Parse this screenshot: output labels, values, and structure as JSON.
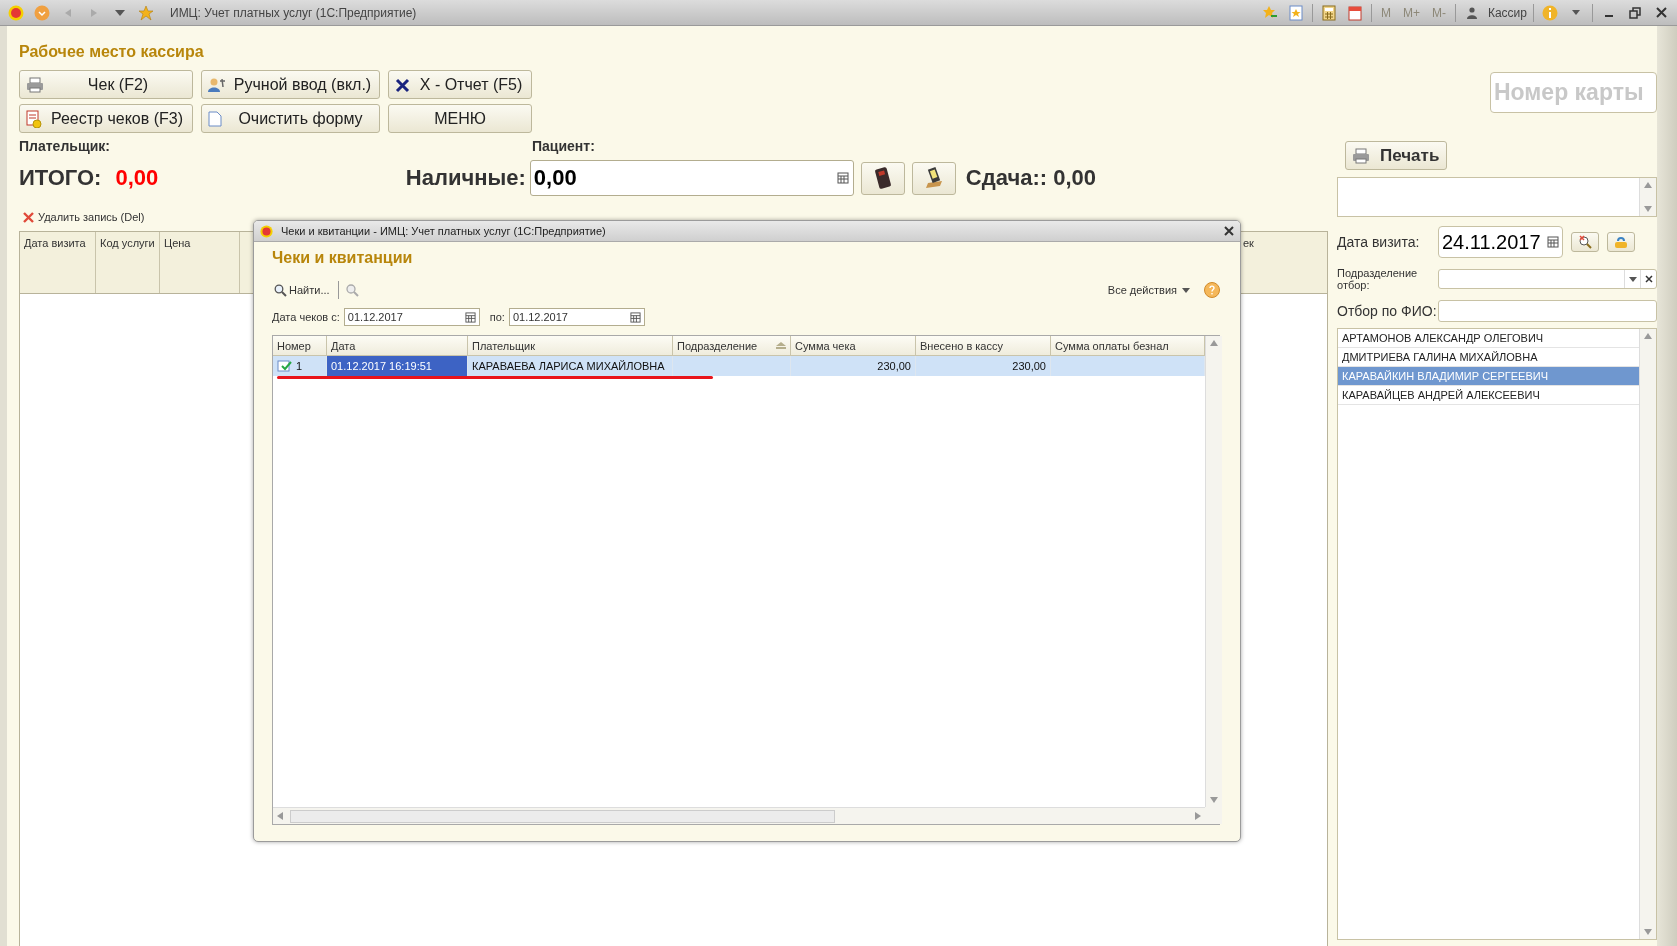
{
  "app_bar": {
    "title": "ИМЦ: Учет платных услуг  (1С:Предприятие)",
    "memory_buttons": [
      {
        "label": "M",
        "disabled": true
      },
      {
        "label": "M+",
        "disabled": true
      },
      {
        "label": "M-",
        "disabled": true
      }
    ],
    "user": "Кассир"
  },
  "form": {
    "title": "Рабочее место кассира",
    "buttons": [
      {
        "label": "Чек (F2)",
        "kind": "printer"
      },
      {
        "label": "Ручной ввод (вкл.)",
        "kind": "manual"
      },
      {
        "label": "X - Отчет (F5)",
        "kind": "report"
      },
      {
        "label": "Реестр чеков (F3)",
        "kind": "registry"
      },
      {
        "label": "Очистить форму",
        "kind": "clear"
      },
      {
        "label": "МЕНЮ",
        "kind": "plain"
      }
    ],
    "payer_label": "Плательщик:",
    "patient_label": "Пациент:",
    "total_label": "ИТОГО:",
    "total_value": "0,00",
    "cash_label": "Наличные:",
    "cash_value": "0,00",
    "change_label": "Сдача::",
    "change_value": "0,00",
    "delete_action": "Удалить запись (Del)",
    "table_columns": [
      "Дата визита",
      "Код услуги",
      "Цена",
      "ек"
    ]
  },
  "side": {
    "card_placeholder": "Номер карты",
    "print_button": "Печать",
    "visit_date_label": "Дата визита:",
    "visit_date": "24.11.2017",
    "department_label": "Подразделение отбор:",
    "name_filter_label": "Отбор по ФИО:",
    "patients": [
      {
        "name": "АРТАМОНОВ АЛЕКСАНДР ОЛЕГОВИЧ",
        "selected": false
      },
      {
        "name": "ДМИТРИЕВА ГАЛИНА МИХАЙЛОВНА",
        "selected": false
      },
      {
        "name": "КАРАВАЙКИН ВЛАДИМИР СЕРГЕЕВИЧ",
        "selected": true
      },
      {
        "name": "КАРАВАЙЦЕВ АНДРЕЙ АЛЕКСЕЕВИЧ",
        "selected": false
      }
    ]
  },
  "dialog": {
    "window_title": "Чеки и квитанции - ИМЦ: Учет платных услуг  (1С:Предприятие)",
    "title": "Чеки и квитанции",
    "find_button": "Найти...",
    "all_actions": "Все действия",
    "date_from_label": "Дата чеков с:",
    "date_from": "01.12.2017",
    "date_to_label": "по:",
    "date_to": "01.12.2017",
    "columns": [
      {
        "label": "Номер",
        "sorted": false
      },
      {
        "label": "Дата",
        "sorted": false
      },
      {
        "label": "Плательщик",
        "sorted": false
      },
      {
        "label": "Подразделение",
        "sorted": true
      },
      {
        "label": "Сумма чека",
        "sorted": false
      },
      {
        "label": "Внесено в кассу",
        "sorted": false
      },
      {
        "label": "Сумма оплаты безнал",
        "sorted": false
      }
    ],
    "rows": [
      {
        "selected": true,
        "underlined": true,
        "posted": true,
        "cells": [
          {
            "text": "1",
            "active": false
          },
          {
            "text": "01.12.2017 16:19:51",
            "active": true
          },
          {
            "text": "КАРАВАЕВА ЛАРИСА МИХАЙЛОВНА",
            "active": false
          },
          {
            "active": false
          },
          {
            "text": "230,00",
            "active": false
          },
          {
            "text": "230,00",
            "active": false
          },
          {
            "active": false
          }
        ]
      }
    ]
  }
}
